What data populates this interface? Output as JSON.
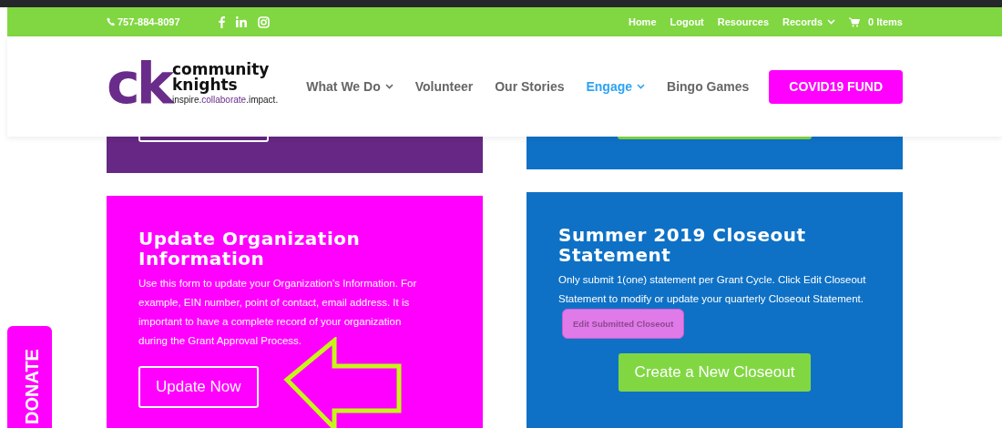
{
  "top_bar": {
    "phone": "757-884-8097",
    "social": [
      {
        "kind": "facebook"
      },
      {
        "kind": "linkedin"
      },
      {
        "kind": "instagram"
      }
    ],
    "links": [
      {
        "label": "Home",
        "dropdown": false
      },
      {
        "label": "Logout",
        "dropdown": false
      },
      {
        "label": "Resources",
        "dropdown": false
      },
      {
        "label": "Records",
        "dropdown": true
      }
    ],
    "cart": "0 Items"
  },
  "logo": {
    "mark": "ck",
    "line1": "community",
    "line2": "knights",
    "tagline": [
      {
        "text": "inspire.",
        "accent": false
      },
      {
        "text": "collaborate",
        "accent": true
      },
      {
        "text": ".impact.",
        "accent": false
      }
    ]
  },
  "nav": [
    {
      "label": "What We Do",
      "kind": "link",
      "dropdown": true,
      "selected": false
    },
    {
      "label": "Volunteer",
      "kind": "link",
      "dropdown": false,
      "selected": false
    },
    {
      "label": "Our Stories",
      "kind": "link",
      "dropdown": false,
      "selected": false
    },
    {
      "label": "Engage",
      "kind": "link",
      "dropdown": true,
      "selected": true
    },
    {
      "label": "Bingo Games",
      "kind": "link",
      "dropdown": false,
      "selected": false
    },
    {
      "label": "COVID19 FUND",
      "kind": "button",
      "selected": false
    }
  ],
  "cards": [
    {
      "title": "Update Organization Information",
      "color": "#ff00ff",
      "text": "Use this form to update your Organization’s Information.  For example, EIN number, point of contact, email address.  It is important to have a complete record of your organization during the Grant Approval Process.",
      "button": "Update Now",
      "kind": "outline"
    },
    {
      "title": "Summer 2019 Closeout Statement",
      "color": "#0e71c6",
      "text": "Only submit 1(one) statement per Grant Cycle. Click Edit Closeout Statement to modify or update your quarterly Closeout Statement.",
      "inline_button": "Edit Submitted Closeout",
      "button": "Create a New Closeout",
      "kind": "solid"
    }
  ],
  "donate_tab": "DONATE"
}
